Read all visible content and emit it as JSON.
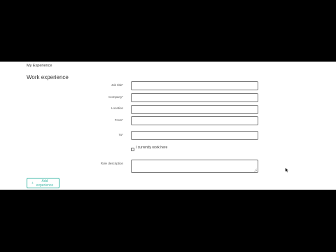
{
  "section_tab": "My Experience",
  "section_title": "Work experience",
  "fields": {
    "job_title": {
      "label": "Job title*",
      "value": ""
    },
    "company": {
      "label": "Company*",
      "value": ""
    },
    "location": {
      "label": "Location",
      "value": ""
    },
    "from": {
      "label": "From*",
      "value": ""
    },
    "to": {
      "label": "To*",
      "value": ""
    }
  },
  "current_job": {
    "label": "I currently work here",
    "checked": false
  },
  "role_description": {
    "label": "Role description",
    "value": ""
  },
  "add_button": {
    "icon": "plus-icon",
    "label": "Add experience"
  }
}
